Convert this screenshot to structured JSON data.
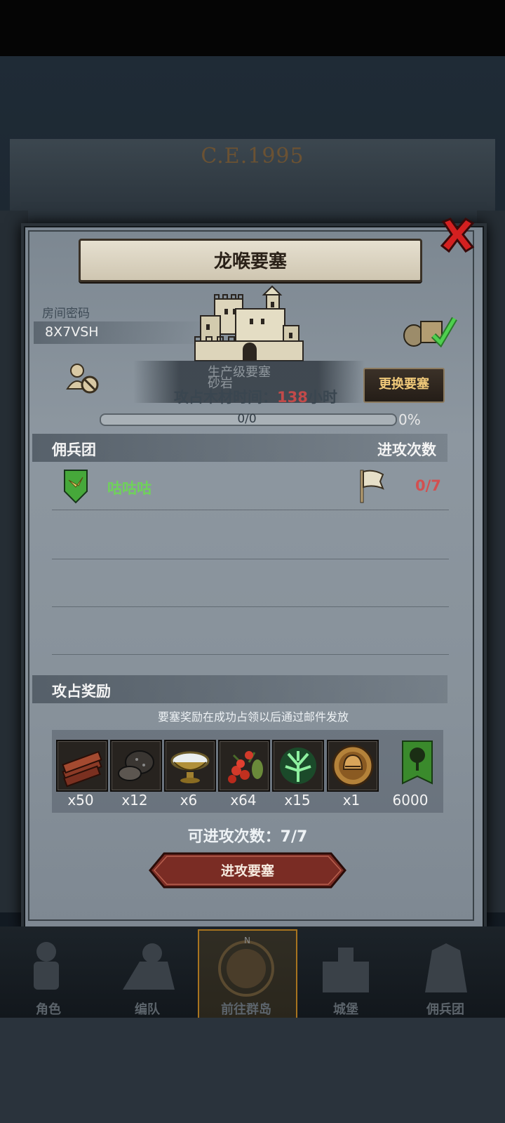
{
  "background": {
    "era": "C.E.1995"
  },
  "dialog": {
    "title": "龙喉要塞",
    "room_label": "房间密码",
    "room_code": "8X7VSH",
    "ghost_line1": "生产级要塞",
    "ghost_line2": "砂岩",
    "occupy_label": "攻占木材时间：",
    "occupy_value": "138",
    "occupy_unit": "小时",
    "change_button": "更换要塞",
    "progress": {
      "count": "0/0",
      "percent_text": "0%",
      "fraction": 0
    },
    "mercenary_header": "佣兵团",
    "attacks_header": "进攻次数",
    "guild": {
      "name": "咕咕咕",
      "attacks": "0/7"
    },
    "rewards_header": "攻占奖励",
    "rewards_note": "要塞奖励在成功占领以后通过邮件发放",
    "rewards": [
      {
        "icon": "wood-icon",
        "qty": "x50"
      },
      {
        "icon": "truffle-icon",
        "qty": "x12"
      },
      {
        "icon": "salt-bowl-icon",
        "qty": "x6"
      },
      {
        "icon": "berries-icon",
        "qty": "x64"
      },
      {
        "icon": "green-spirit-icon",
        "qty": "x15"
      },
      {
        "icon": "helmet-medal-icon",
        "qty": "x1"
      },
      {
        "icon": "tree-banner-icon",
        "qty": "6000"
      }
    ],
    "attack_count_label": "可进攻次数：",
    "attack_count_value": "7/7",
    "attack_button": "进攻要塞"
  },
  "nav": {
    "items": [
      {
        "label": "角色",
        "icon": "knight-icon"
      },
      {
        "label": "编队",
        "icon": "squad-icon"
      },
      {
        "label": "前往群岛",
        "icon": "compass-icon"
      },
      {
        "label": "城堡",
        "icon": "castle-icon"
      },
      {
        "label": "佣兵团",
        "icon": "mercenary-icon"
      }
    ],
    "active_index": 2
  },
  "colors": {
    "accent_orange": "#f0c97a",
    "guild_green": "#6fd25a",
    "warning_red": "#d25050",
    "close_red": "#d42020"
  }
}
